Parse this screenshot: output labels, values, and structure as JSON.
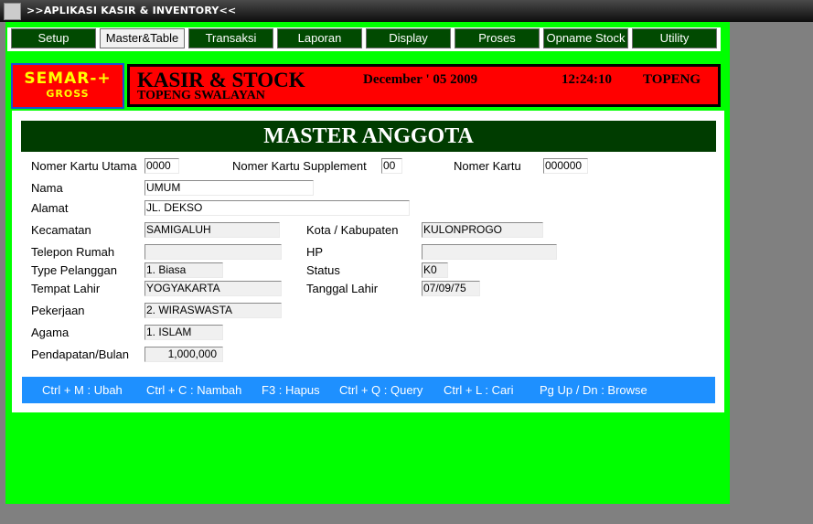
{
  "window": {
    "title": ">>APLIKASI KASIR & INVENTORY<<"
  },
  "menu": [
    "Setup",
    "Master&Table",
    "Transaksi",
    "Laporan",
    "Display",
    "Proses",
    "Opname Stock",
    "Utility"
  ],
  "logo": {
    "line1": "SEMAR-+",
    "line2": "GROSS",
    "color": "#ffff00",
    "background": "#ff0000"
  },
  "banner": {
    "title": "KASIR & STOCK",
    "subtitle": "TOPENG SWALAYAN",
    "date": "December ' 05 2009",
    "time": "12:24:10",
    "store": "TOPENG",
    "background": "#ff0000"
  },
  "form": {
    "title": "MASTER ANGGOTA",
    "labels": {
      "nomor_kartu_utama": "Nomer Kartu Utama",
      "nomor_kartu_supplement": "Nomer Kartu Supplement",
      "nomor_kartu": "Nomer Kartu",
      "nama": "Nama",
      "alamat": "Alamat",
      "kecamatan": "Kecamatan",
      "kota": "Kota / Kabupaten",
      "telepon": "Telepon Rumah",
      "hp": "HP",
      "type": "Type Pelanggan",
      "status": "Status",
      "tempat_lahir": "Tempat Lahir",
      "tanggal_lahir": "Tanggal Lahir",
      "pekerjaan": "Pekerjaan",
      "agama": "Agama",
      "pendapatan": "Pendapatan/Bulan"
    },
    "values": {
      "nomor_kartu_utama": "0000",
      "nomor_kartu_supplement": "00",
      "nomor_kartu": "000000",
      "nama": "UMUM",
      "alamat": "JL. DEKSO",
      "kecamatan": "SAMIGALUH",
      "kota": "KULONPROGO",
      "telepon": "",
      "hp": "",
      "type": "1. Biasa",
      "status": "K0",
      "tempat_lahir": "YOGYAKARTA",
      "tanggal_lahir": "07/09/75",
      "pekerjaan": "2. WIRASWASTA",
      "agama": "1. ISLAM",
      "pendapatan": "1,000,000"
    }
  },
  "hotkeys": [
    "Ctrl + M : Ubah",
    "Ctrl + C : Nambah",
    "F3 : Hapus",
    "Ctrl + Q : Query",
    "Ctrl + L : Cari",
    "Pg Up / Dn : Browse"
  ],
  "colors": {
    "frame": "#00ff00",
    "header": "#003c00",
    "hotkey_bar": "#1e90ff",
    "tab": "#014a01"
  }
}
